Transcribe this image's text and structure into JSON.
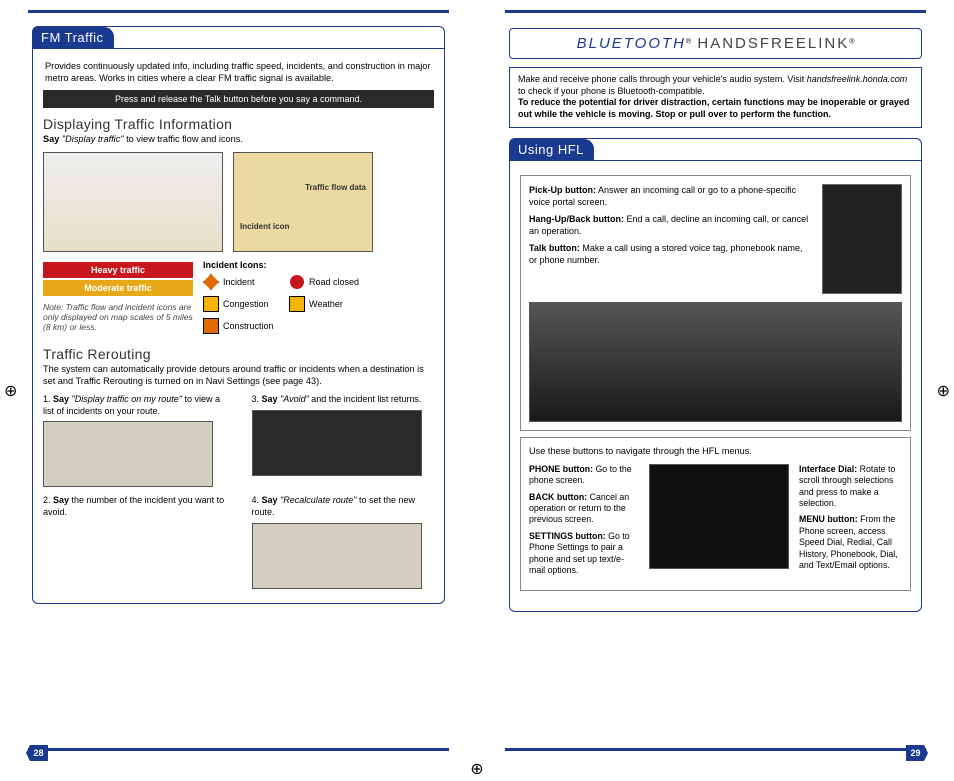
{
  "left": {
    "section_title": "FM Traffic",
    "intro": "Provides continuously updated info, including traffic speed, incidents, and construction in major metro areas. Works in cities where a clear FM traffic signal is available.",
    "black_bar": "Press and release the Talk button before you say a command.",
    "h1": "Displaying Traffic Information",
    "h1_body_prefix": "Say ",
    "h1_body_quote": "\"Display traffic\"",
    "h1_body_suffix": " to view traffic flow and icons.",
    "legend_heavy": "Heavy traffic",
    "legend_moderate": "Moderate traffic",
    "note": "Note: Traffic flow and incident icons are only displayed on map scales of 5 miles (8 km) or less.",
    "icons_title": "Incident Icons:",
    "icons": {
      "incident": "Incident",
      "road_closed": "Road closed",
      "congestion": "Congestion",
      "weather": "Weather",
      "construction": "Construction"
    },
    "map2_label1": "Incident icon",
    "map2_label2": "Traffic flow data",
    "h2": "Traffic Rerouting",
    "h2_body": "The system can automatically provide detours around traffic or incidents when a destination is set and Traffic Rerouting is turned on in Navi Settings (see page 43).",
    "step1_pre": "1. ",
    "step1_b": "Say ",
    "step1_q": "\"Display traffic on my route\"",
    "step1_post": " to view a list of incidents on your route.",
    "step2_pre": "2. ",
    "step2_b": "Say ",
    "step2_post": "the number of the incident you want to avoid.",
    "step3_pre": "3. ",
    "step3_b": "Say ",
    "step3_q": "\"Avoid\"",
    "step3_post": " and the incident list returns.",
    "step4_pre": "4. ",
    "step4_b": "Say ",
    "step4_q": "\"Recalculate route\"",
    "step4_post": " to set the new route.",
    "page_num": "28"
  },
  "right": {
    "title_bt": "BLUETOOTH",
    "title_hfl": " HANDSFREELINK",
    "info1a": "Make and receive phone calls through your vehicle's audio system. Visit ",
    "info1b": "handsfreelink.honda.com",
    "info1c": " to check if your phone is Bluetooth-compatible.",
    "info2": "To reduce the potential for driver distraction, certain functions may be inoperable or grayed out while the vehicle is moving. Stop or pull over to perform the function.",
    "section_title": "Using HFL",
    "pickup_b": "Pick-Up button:",
    "pickup_t": " Answer an incoming call or go to a phone-specific voice portal screen.",
    "hangup_b": "Hang-Up/Back button:",
    "hangup_t": " End a call, decline an incoming call, or cancel an operation.",
    "talk_b": "Talk button:",
    "talk_t": " Make a call using a stored voice tag, phonebook name, or phone number.",
    "nav_caption": "Use these buttons to navigate through the HFL menus.",
    "phone_b": "PHONE button:",
    "phone_t": " Go to the phone screen.",
    "back_b": "BACK button:",
    "back_t": " Cancel an operation or return to the previous screen.",
    "settings_b": "SETTINGS button:",
    "settings_t": " Go to Phone Settings to pair a phone and set up text/e-mail options.",
    "dial_b": "Interface Dial:",
    "dial_t": " Rotate to scroll through selections and press to make a selection.",
    "menu_b": "MENU button:",
    "menu_t": " From the Phone screen, access Speed Dial, Redial, Call History, Phonebook, Dial, and Text/Email options.",
    "page_num": "29"
  }
}
